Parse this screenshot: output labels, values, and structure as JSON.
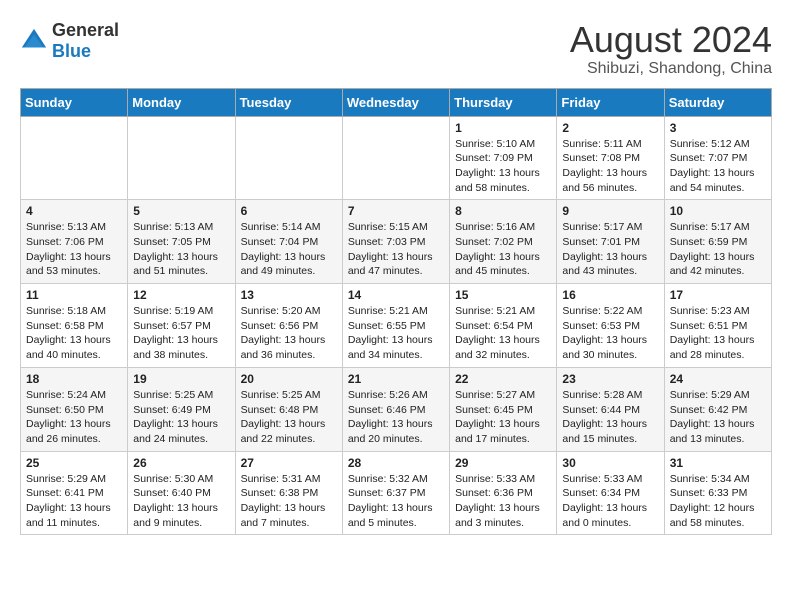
{
  "logo": {
    "general": "General",
    "blue": "Blue"
  },
  "title": "August 2024",
  "subtitle": "Shibuzi, Shandong, China",
  "days_of_week": [
    "Sunday",
    "Monday",
    "Tuesday",
    "Wednesday",
    "Thursday",
    "Friday",
    "Saturday"
  ],
  "weeks": [
    [
      {
        "day": "",
        "info": ""
      },
      {
        "day": "",
        "info": ""
      },
      {
        "day": "",
        "info": ""
      },
      {
        "day": "",
        "info": ""
      },
      {
        "day": "1",
        "info": "Sunrise: 5:10 AM\nSunset: 7:09 PM\nDaylight: 13 hours\nand 58 minutes."
      },
      {
        "day": "2",
        "info": "Sunrise: 5:11 AM\nSunset: 7:08 PM\nDaylight: 13 hours\nand 56 minutes."
      },
      {
        "day": "3",
        "info": "Sunrise: 5:12 AM\nSunset: 7:07 PM\nDaylight: 13 hours\nand 54 minutes."
      }
    ],
    [
      {
        "day": "4",
        "info": "Sunrise: 5:13 AM\nSunset: 7:06 PM\nDaylight: 13 hours\nand 53 minutes."
      },
      {
        "day": "5",
        "info": "Sunrise: 5:13 AM\nSunset: 7:05 PM\nDaylight: 13 hours\nand 51 minutes."
      },
      {
        "day": "6",
        "info": "Sunrise: 5:14 AM\nSunset: 7:04 PM\nDaylight: 13 hours\nand 49 minutes."
      },
      {
        "day": "7",
        "info": "Sunrise: 5:15 AM\nSunset: 7:03 PM\nDaylight: 13 hours\nand 47 minutes."
      },
      {
        "day": "8",
        "info": "Sunrise: 5:16 AM\nSunset: 7:02 PM\nDaylight: 13 hours\nand 45 minutes."
      },
      {
        "day": "9",
        "info": "Sunrise: 5:17 AM\nSunset: 7:01 PM\nDaylight: 13 hours\nand 43 minutes."
      },
      {
        "day": "10",
        "info": "Sunrise: 5:17 AM\nSunset: 6:59 PM\nDaylight: 13 hours\nand 42 minutes."
      }
    ],
    [
      {
        "day": "11",
        "info": "Sunrise: 5:18 AM\nSunset: 6:58 PM\nDaylight: 13 hours\nand 40 minutes."
      },
      {
        "day": "12",
        "info": "Sunrise: 5:19 AM\nSunset: 6:57 PM\nDaylight: 13 hours\nand 38 minutes."
      },
      {
        "day": "13",
        "info": "Sunrise: 5:20 AM\nSunset: 6:56 PM\nDaylight: 13 hours\nand 36 minutes."
      },
      {
        "day": "14",
        "info": "Sunrise: 5:21 AM\nSunset: 6:55 PM\nDaylight: 13 hours\nand 34 minutes."
      },
      {
        "day": "15",
        "info": "Sunrise: 5:21 AM\nSunset: 6:54 PM\nDaylight: 13 hours\nand 32 minutes."
      },
      {
        "day": "16",
        "info": "Sunrise: 5:22 AM\nSunset: 6:53 PM\nDaylight: 13 hours\nand 30 minutes."
      },
      {
        "day": "17",
        "info": "Sunrise: 5:23 AM\nSunset: 6:51 PM\nDaylight: 13 hours\nand 28 minutes."
      }
    ],
    [
      {
        "day": "18",
        "info": "Sunrise: 5:24 AM\nSunset: 6:50 PM\nDaylight: 13 hours\nand 26 minutes."
      },
      {
        "day": "19",
        "info": "Sunrise: 5:25 AM\nSunset: 6:49 PM\nDaylight: 13 hours\nand 24 minutes."
      },
      {
        "day": "20",
        "info": "Sunrise: 5:25 AM\nSunset: 6:48 PM\nDaylight: 13 hours\nand 22 minutes."
      },
      {
        "day": "21",
        "info": "Sunrise: 5:26 AM\nSunset: 6:46 PM\nDaylight: 13 hours\nand 20 minutes."
      },
      {
        "day": "22",
        "info": "Sunrise: 5:27 AM\nSunset: 6:45 PM\nDaylight: 13 hours\nand 17 minutes."
      },
      {
        "day": "23",
        "info": "Sunrise: 5:28 AM\nSunset: 6:44 PM\nDaylight: 13 hours\nand 15 minutes."
      },
      {
        "day": "24",
        "info": "Sunrise: 5:29 AM\nSunset: 6:42 PM\nDaylight: 13 hours\nand 13 minutes."
      }
    ],
    [
      {
        "day": "25",
        "info": "Sunrise: 5:29 AM\nSunset: 6:41 PM\nDaylight: 13 hours\nand 11 minutes."
      },
      {
        "day": "26",
        "info": "Sunrise: 5:30 AM\nSunset: 6:40 PM\nDaylight: 13 hours\nand 9 minutes."
      },
      {
        "day": "27",
        "info": "Sunrise: 5:31 AM\nSunset: 6:38 PM\nDaylight: 13 hours\nand 7 minutes."
      },
      {
        "day": "28",
        "info": "Sunrise: 5:32 AM\nSunset: 6:37 PM\nDaylight: 13 hours\nand 5 minutes."
      },
      {
        "day": "29",
        "info": "Sunrise: 5:33 AM\nSunset: 6:36 PM\nDaylight: 13 hours\nand 3 minutes."
      },
      {
        "day": "30",
        "info": "Sunrise: 5:33 AM\nSunset: 6:34 PM\nDaylight: 13 hours\nand 0 minutes."
      },
      {
        "day": "31",
        "info": "Sunrise: 5:34 AM\nSunset: 6:33 PM\nDaylight: 12 hours\nand 58 minutes."
      }
    ]
  ]
}
